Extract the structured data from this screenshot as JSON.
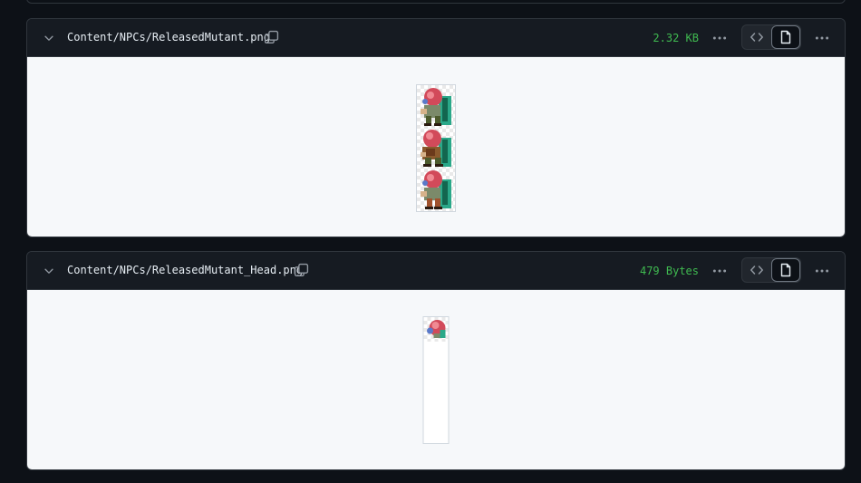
{
  "files": [
    {
      "path": "Content/NPCs/ReleasedMutant.png",
      "size": "2.32 KB",
      "view_modes": [
        "code-view",
        "file-view"
      ]
    },
    {
      "path": "Content/NPCs/ReleasedMutant_Head.png",
      "size": "479 Bytes",
      "view_modes": [
        "code-view",
        "file-view"
      ]
    }
  ],
  "colors": {
    "size_text": "#3fb950",
    "header_bg": "#161b22",
    "body_bg": "#f6f8fa",
    "page_bg": "#0d1117"
  },
  "icons": {
    "collapse": "chevron-down-icon",
    "copy": "copy-icon",
    "more": "kebab-horizontal-icon",
    "code": "code-icon",
    "file": "file-icon"
  }
}
